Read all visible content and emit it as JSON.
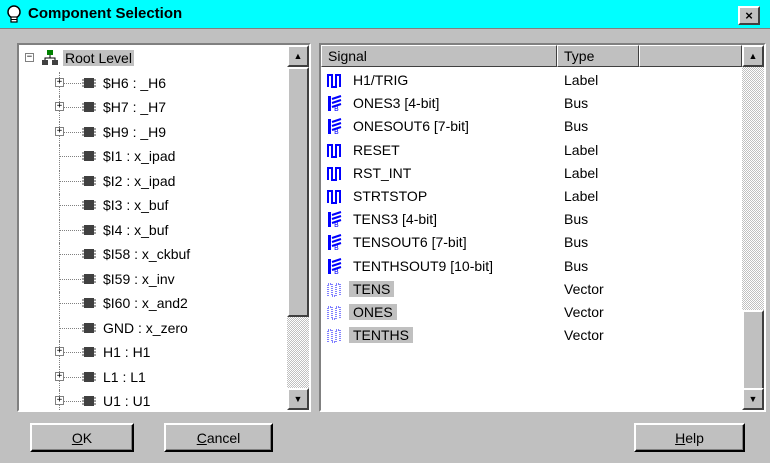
{
  "window": {
    "title": "Component Selection",
    "close_glyph": "×",
    "title_icon": "lightbulb-icon"
  },
  "tree": {
    "items": [
      {
        "label": "Root Level",
        "expander": "−",
        "selected": true
      },
      {
        "label": "$H6 : _H6",
        "expander": "+"
      },
      {
        "label": "$H7 : _H7",
        "expander": "+"
      },
      {
        "label": "$H9 : _H9",
        "expander": "+"
      },
      {
        "label": "$I1 : x_ipad",
        "expander": ""
      },
      {
        "label": "$I2 : x_ipad",
        "expander": ""
      },
      {
        "label": "$I3 : x_buf",
        "expander": ""
      },
      {
        "label": "$I4 : x_buf",
        "expander": ""
      },
      {
        "label": "$I58 : x_ckbuf",
        "expander": ""
      },
      {
        "label": "$I59 : x_inv",
        "expander": ""
      },
      {
        "label": "$I60 : x_and2",
        "expander": ""
      },
      {
        "label": "GND : x_zero",
        "expander": ""
      },
      {
        "label": "H1 : H1",
        "expander": "+"
      },
      {
        "label": "L1 : L1",
        "expander": "+"
      },
      {
        "label": "U1 : U1",
        "expander": "+"
      }
    ]
  },
  "table": {
    "columns": [
      "Signal",
      "Type",
      ""
    ],
    "rows": [
      {
        "signal": "H1/TRIG",
        "type": "Label",
        "icon": "label-icon"
      },
      {
        "signal": "ONES3 [4-bit]",
        "type": "Bus",
        "icon": "bus-icon"
      },
      {
        "signal": "ONESOUT6 [7-bit]",
        "type": "Bus",
        "icon": "bus-icon"
      },
      {
        "signal": "RESET",
        "type": "Label",
        "icon": "label-icon"
      },
      {
        "signal": "RST_INT",
        "type": "Label",
        "icon": "label-icon"
      },
      {
        "signal": "STRTSTOP",
        "type": "Label",
        "icon": "label-icon"
      },
      {
        "signal": "TENS3 [4-bit]",
        "type": "Bus",
        "icon": "bus-icon"
      },
      {
        "signal": "TENSOUT6 [7-bit]",
        "type": "Bus",
        "icon": "bus-icon"
      },
      {
        "signal": "TENTHSOUT9 [10-bit]",
        "type": "Bus",
        "icon": "bus-icon"
      },
      {
        "signal": "TENS",
        "type": "Vector",
        "icon": "vector-icon",
        "selected": true
      },
      {
        "signal": "ONES",
        "type": "Vector",
        "icon": "vector-icon",
        "selected": true
      },
      {
        "signal": "TENTHS",
        "type": "Vector",
        "icon": "vector-icon",
        "selected": true
      }
    ]
  },
  "buttons": {
    "ok": {
      "mnemonic": "O",
      "rest": "K"
    },
    "cancel": {
      "mnemonic": "C",
      "rest": "ancel"
    },
    "help": {
      "mnemonic": "H",
      "rest": "elp"
    }
  },
  "colors": {
    "titlebar": "#00ffff",
    "face": "#c0c0c0",
    "signal_blue": "#0000ff"
  }
}
